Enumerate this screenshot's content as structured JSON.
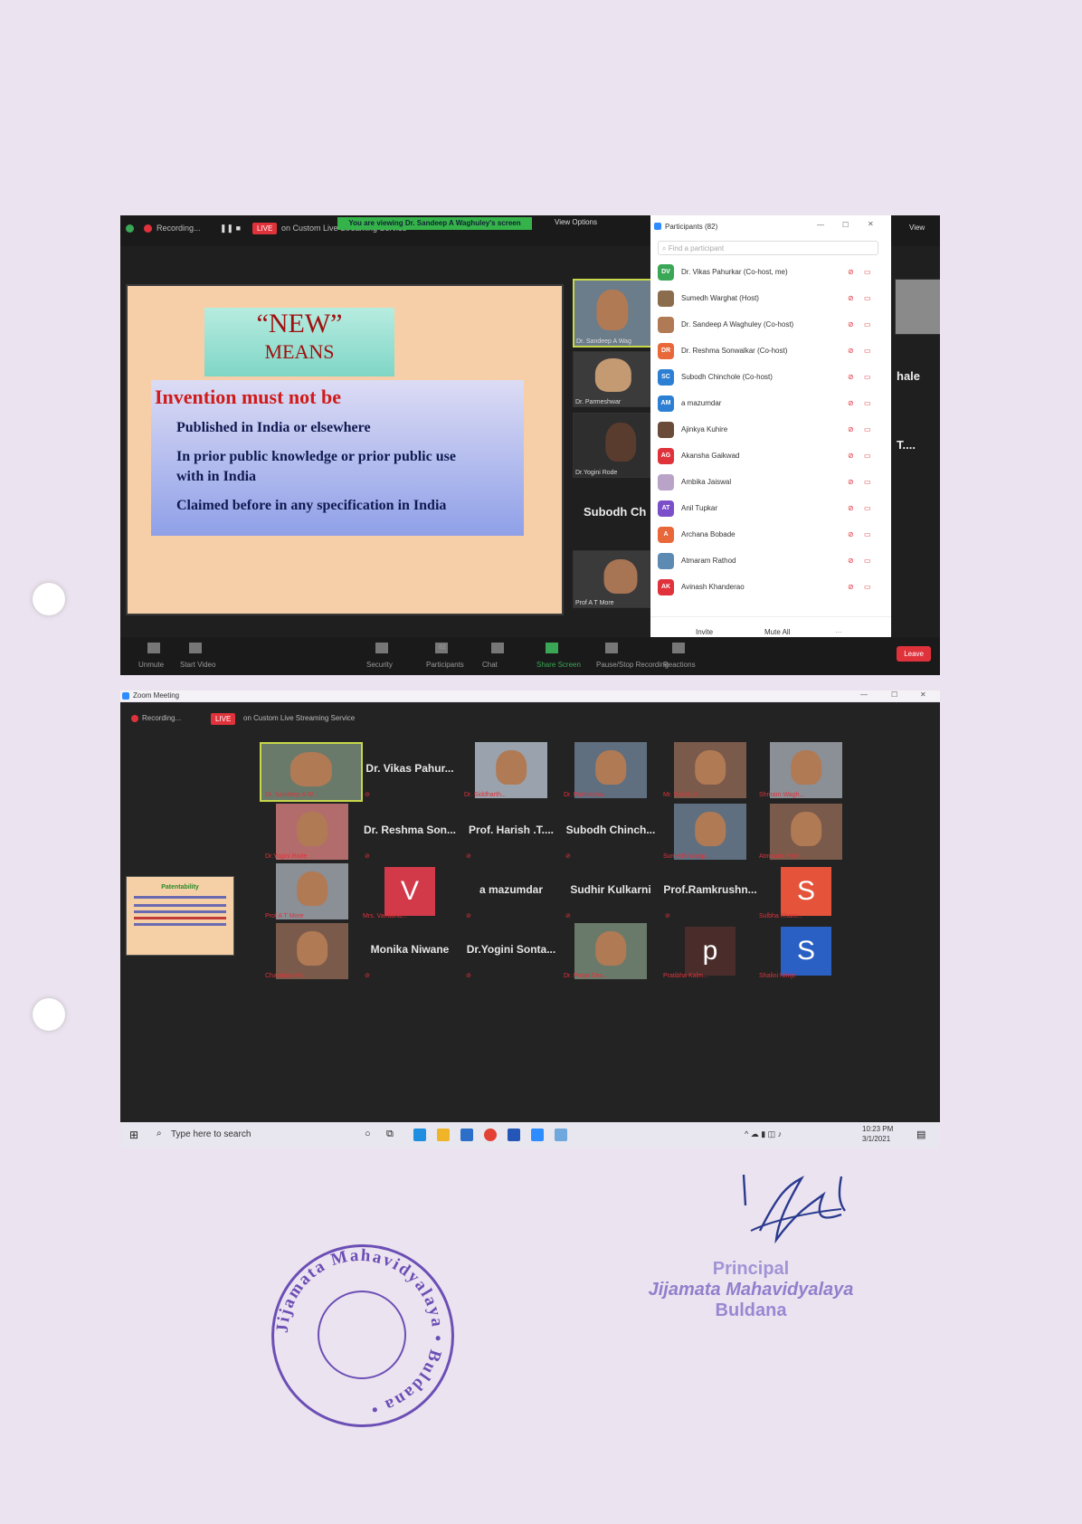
{
  "top": {
    "recording": "Recording...",
    "live": "LIVE",
    "streaming": "on Custom Live Streaming Service",
    "viewing": "You are viewing Dr. Sandeep A Waghuley's screen",
    "view_options": "View Options",
    "view": "View",
    "slide": {
      "new_title": "“NEW”",
      "means": "MEANS",
      "heading": "Invention must not be",
      "lines": [
        "Published in India or elsewhere",
        "In prior public knowledge or prior public use with in India",
        "Claimed  before in any specification in India"
      ]
    },
    "thumbs": [
      "Dr. Sandeep A Wag",
      "Dr. Parmeshwar",
      "Dr.Yogini Rode",
      "Prof A T More"
    ],
    "names": {
      "subodh": "Subodh Ch",
      "hale": "hale",
      "t": "T...."
    },
    "toolbar": [
      "Unmute",
      "Start Video",
      "Security",
      "Participants",
      "Chat",
      "Share Screen",
      "Pause/Stop Recording",
      "Reactions"
    ],
    "participants_count": "82",
    "leave": "Leave",
    "panel": {
      "title": "Participants (82)",
      "find": "Find a participant",
      "invite": "Invite",
      "mute_all": "Mute All",
      "items": [
        {
          "initials": "DV",
          "name": "Dr. Vikas Pahurkar (Co-host, me)",
          "color": "#3aa757"
        },
        {
          "initials": "",
          "name": "Sumedh Warghat (Host)",
          "color": "#8b6d4e"
        },
        {
          "initials": "",
          "name": "Dr. Sandeep A Waghuley (Co-host)",
          "color": "#b07a55"
        },
        {
          "initials": "DR",
          "name": "Dr. Reshma Sonwalkar (Co-host)",
          "color": "#e8683a"
        },
        {
          "initials": "SC",
          "name": "Subodh Chinchole (Co-host)",
          "color": "#2d7fd3"
        },
        {
          "initials": "AM",
          "name": "a mazumdar",
          "color": "#2d7fd3"
        },
        {
          "initials": "",
          "name": "Ajinkya Kuhire",
          "color": "#6a4b3a"
        },
        {
          "initials": "AG",
          "name": "Akansha Gaikwad",
          "color": "#e0323b"
        },
        {
          "initials": "",
          "name": "Ambika Jaiswal",
          "color": "#b9a4c8"
        },
        {
          "initials": "AT",
          "name": "Anil Tupkar",
          "color": "#7b4fc9"
        },
        {
          "initials": "A",
          "name": "Archana Bobade",
          "color": "#e8683a"
        },
        {
          "initials": "",
          "name": "Atmaram Rathod",
          "color": "#5d8ab3"
        },
        {
          "initials": "AK",
          "name": "Avinash Khanderao",
          "color": "#e0323b"
        }
      ]
    }
  },
  "bottom": {
    "app_title": "Zoom Meeting",
    "recording": "Recording...",
    "live": "LIVE",
    "streaming": "on Custom Live Streaming Service",
    "slide_title": "Patentability",
    "tiles": [
      {
        "type": "video",
        "caption": "Dr. Sandeep A W..."
      },
      {
        "type": "name",
        "label": "Dr. Vikas Pahur..."
      },
      {
        "type": "video",
        "caption": "Dr. Siddharth..."
      },
      {
        "type": "video",
        "caption": "Dr. Parmeshw..."
      },
      {
        "type": "video",
        "caption": "Mr. Vishal D..."
      },
      {
        "type": "video",
        "caption": "Shriram Wagh..."
      },
      {
        "type": "video",
        "caption": "Dr.Yogini Rode"
      },
      {
        "type": "name",
        "label": "Dr. Reshma Son..."
      },
      {
        "type": "name",
        "label": "Prof. Harish .T...."
      },
      {
        "type": "name",
        "label": "Subodh Chinch..."
      },
      {
        "type": "video",
        "caption": "Sumedh Wargi..."
      },
      {
        "type": "video",
        "caption": "Atmaram Rath..."
      },
      {
        "type": "video",
        "caption": "Prof A T More"
      },
      {
        "type": "letter",
        "letter": "V",
        "color": "#d23a4a",
        "caption": "Mrs. Vandana..."
      },
      {
        "type": "name",
        "label": "a mazumdar"
      },
      {
        "type": "name",
        "label": "Sudhir Kulkarni"
      },
      {
        "type": "name",
        "label": "Prof.Ramkrushn..."
      },
      {
        "type": "letter",
        "letter": "S",
        "color": "#e5533a",
        "caption": "Sulbha Kharc..."
      },
      {
        "type": "video",
        "caption": "Chandrashek..."
      },
      {
        "type": "name",
        "label": "Monika Niwane"
      },
      {
        "type": "name",
        "label": "Dr.Yogini Sonta..."
      },
      {
        "type": "video",
        "caption": "Dr. Pooja Des..."
      },
      {
        "type": "letter",
        "letter": "p",
        "color": "#4a2d2a",
        "caption": "Pratibha Kalm..."
      },
      {
        "type": "letter",
        "letter": "S",
        "color": "#2a5fc4",
        "caption": "Shalini Nimje"
      }
    ],
    "taskbar": {
      "search": "Type here to search",
      "time": "10:23 PM",
      "date": "3/1/2021"
    }
  },
  "signature": {
    "title": "Principal",
    "org": "Jijamata Mahavidyalaya",
    "city": "Buldana"
  },
  "stamp": {
    "text": "Jijamata Mahavidyalaya • Buldana •"
  }
}
